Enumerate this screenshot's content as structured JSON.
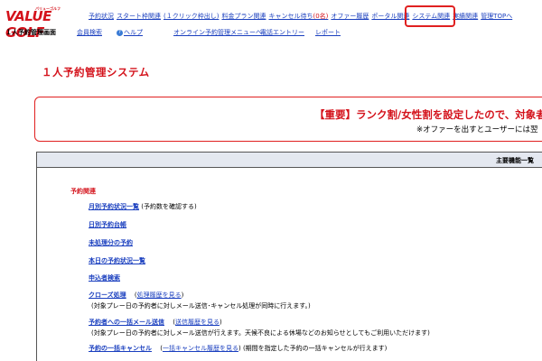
{
  "logo": {
    "text": "VALUE GOLF",
    "small_text": "バリューゴルフ"
  },
  "nav_top": {
    "items": [
      "予約状況",
      "スタート枠関連",
      "(１クリック枠出し)",
      "料金プラン関連",
      "キャンセル待ち",
      "(0名)",
      "オファー履歴",
      "ポータル関連",
      "システム関連",
      "実績関連",
      "管理TOPへ"
    ]
  },
  "nav_sub": {
    "current": "１人予約管理画面",
    "member_search": "会員検索",
    "help": "ヘルプ",
    "online_menu": "オンライン予約管理メニューへ",
    "phone_entry": "電話エントリー",
    "report": "レポート"
  },
  "page": {
    "title": "１人予約管理システム"
  },
  "notice": {
    "line1": "【重要】ランク割/女性割を設定したので、対象者にオ",
    "line2": "※オファーを出すとユーザーには翌"
  },
  "panel": {
    "header": "主要機能一覧",
    "section_label": "予約関連",
    "items": [
      {
        "label": "月別予約状況一覧",
        "note": "(予約数を確認する)"
      },
      {
        "label": "日別予約台帳"
      },
      {
        "label": "未処理分の予約"
      },
      {
        "label": "本日の予約状況一覧"
      },
      {
        "label": "申込者検索"
      },
      {
        "label": "クローズ処理",
        "link": "処理履歴を見る",
        "sub": "(対象プレー日の予約者に対しメール送信･キャンセル処理が同時に行えます。)"
      },
      {
        "label": "予約者への一括メール送信",
        "link": "送信履歴を見る",
        "sub": "(対象プレー日の予約者に対しメール送信が行えます。天候不良による休場などのお知らせとしてもご利用いただけます)"
      },
      {
        "label": "予約の一括キャンセル",
        "link": "一括キャンセル履歴を見る",
        "note": "(期間を指定した予約の一括キャンセルが行えます)"
      }
    ]
  },
  "colors": {
    "brand_red": "#d4121b",
    "link_blue": "#1a3fbf",
    "highlight": "#e02020"
  }
}
